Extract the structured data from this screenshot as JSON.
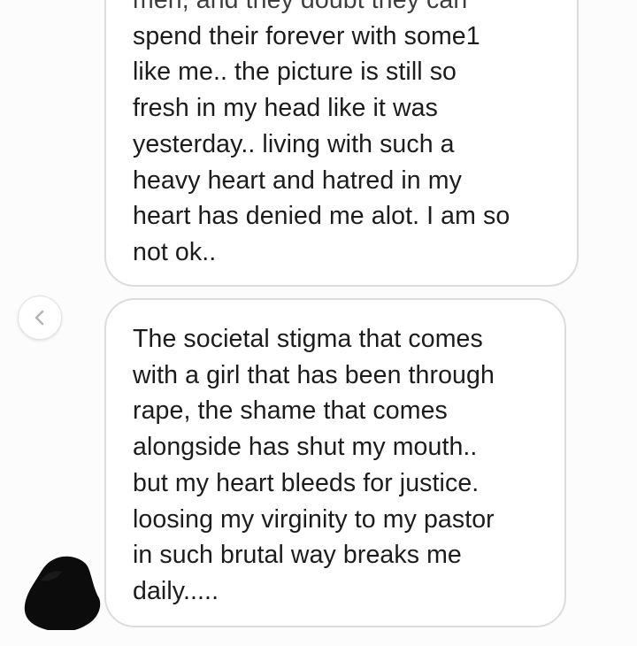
{
  "conversation": {
    "messages": [
      {
        "id": "message-1",
        "lines": [
          "men, and they doubt they can",
          "spend their forever with some1",
          "like me.. the picture is still so",
          "fresh in my head like it was",
          "yesterday.. living with such a",
          "heavy heart and hatred in my",
          "heart has denied me alot. I am so",
          "not ok.."
        ]
      },
      {
        "id": "message-2",
        "lines": [
          "The societal stigma that comes",
          "with a girl that has been through",
          "rape, the shame that comes",
          "alongside has shut my mouth..",
          "but my heart bleeds for justice.",
          "loosing my virginity to my pastor",
          "in such brutal way breaks me",
          "daily....."
        ]
      }
    ]
  },
  "controls": {
    "back_icon": "chevron-left-icon"
  },
  "avatar": {
    "icon": "redacted-avatar",
    "color": "#0c0c0c"
  },
  "colors": {
    "bubble_bg": "#ffffff",
    "bubble_border": "#dcdcdc",
    "text": "#1c1c1c",
    "page_bg": "#fcfcfc"
  }
}
